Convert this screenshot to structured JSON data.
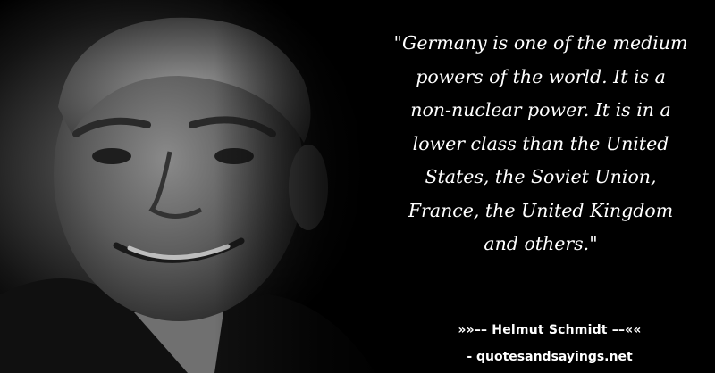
{
  "quote": {
    "lines": [
      "\"Germany is one of the medium",
      "powers of the world. It is a",
      "non-nuclear power. It is in a",
      "lower class than the United",
      "States, the Soviet Union,",
      "France, the United Kingdom",
      "and others.\""
    ]
  },
  "author": "»»–– Helmut Schmidt ––««",
  "source": "- quotesandsayings.net"
}
